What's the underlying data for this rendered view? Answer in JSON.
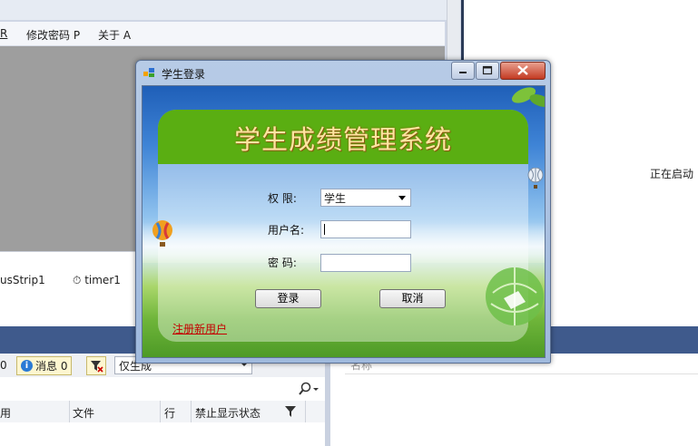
{
  "ide": {
    "menu": {
      "item_r": "R",
      "change_password": "修改密码 P",
      "about": "关于 A"
    },
    "tray": {
      "status_strip": "usStrip1",
      "timer": "timer1"
    },
    "right_status": "正在启动",
    "error_list": {
      "errors_count": "0",
      "messages_label": "消息 0",
      "scope": "仅生成",
      "columns": [
        "用",
        "文件",
        "行",
        "禁止显示状态"
      ]
    },
    "name_panel": {
      "column": "名称"
    }
  },
  "dialog": {
    "title": "学生登录",
    "system_title": "学生成绩管理系统",
    "role_label": "权  限:",
    "role_value": "学生",
    "username_label": "用户名:",
    "username_value": "",
    "password_label": "密  码:",
    "password_value": "",
    "login_button": "登录",
    "cancel_button": "取消",
    "register_link": "注册新用户"
  },
  "colors": {
    "banner_green": "#5aae12",
    "title_gold": "#ffe6a1",
    "link_red": "#c40000",
    "ide_blue": "#3f5a8c"
  }
}
